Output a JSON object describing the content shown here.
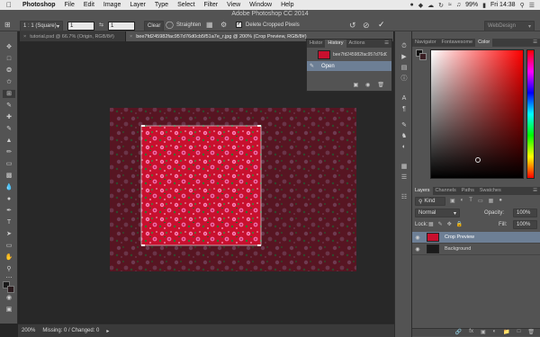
{
  "menubar": {
    "app": "Photoshop",
    "items": [
      "File",
      "Edit",
      "Image",
      "Layer",
      "Type",
      "Select",
      "Filter",
      "View",
      "Window",
      "Help"
    ],
    "battery": "99%",
    "clock": "Fri 14:38"
  },
  "options": {
    "ratio": "1 : 1 (Square)",
    "w": "1",
    "h": "1",
    "clear": "Clear",
    "straighten": "Straighten",
    "delete_cropped": "Delete Cropped Pixels",
    "workspace": "WebDesign",
    "app_title": "Adobe Photoshop CC 2014"
  },
  "tabs": [
    {
      "label": "tutorial.psd @ 66.7% (Origin, RGB/8#)"
    },
    {
      "label": "bee7fd245982fac957d76d0cb5f51a7e_r.jpg @ 200% (Crop Preview, RGB/8#)"
    }
  ],
  "history": {
    "tabs": [
      "Histor",
      "History",
      "Actions"
    ],
    "snapshot": "bee7fd245982fac957d76d0...",
    "step": "Open"
  },
  "color": {
    "tabs": [
      "Navigator",
      "Fontawesome",
      "Color"
    ]
  },
  "layers": {
    "tabs": [
      "Layers",
      "Channels",
      "Paths",
      "Swatches"
    ],
    "kind": "Kind",
    "blend": "Normal",
    "opacity_label": "Opacity:",
    "opacity": "100%",
    "lock_label": "Lock:",
    "fill_label": "Fill:",
    "fill": "100%",
    "rows": [
      {
        "name": "Crop Preview"
      },
      {
        "name": "Background"
      }
    ]
  },
  "status": {
    "zoom": "200%",
    "info": "Missing: 0 / Changed: 0"
  },
  "colors": {
    "accent_selected": "#6d7f95",
    "fabric_red": "#c8102e"
  }
}
